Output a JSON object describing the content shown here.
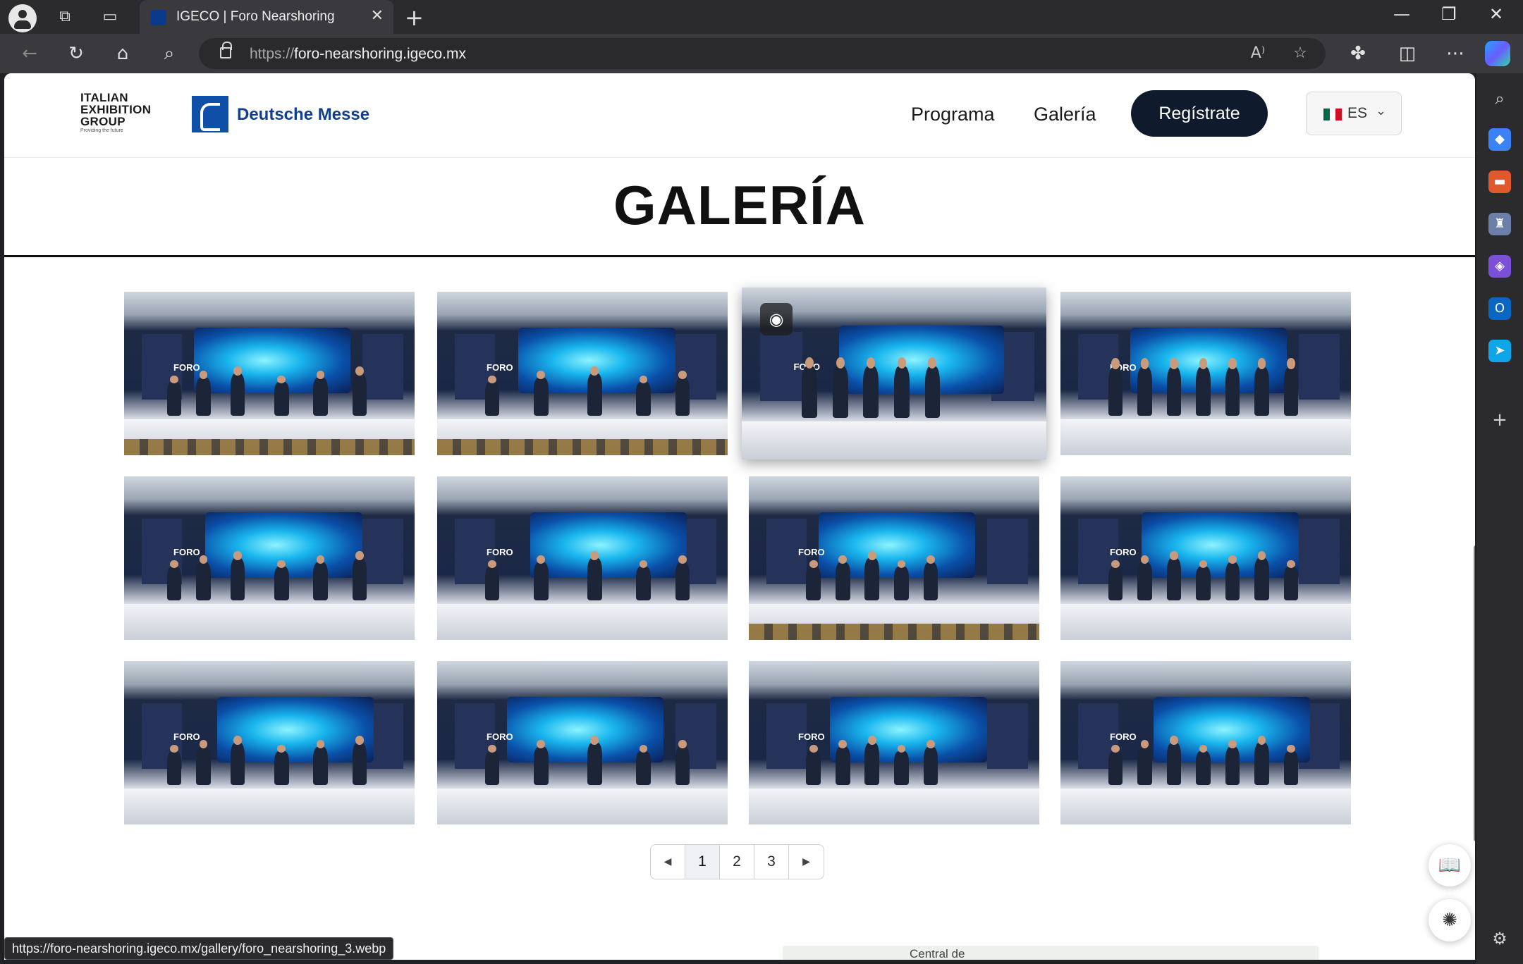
{
  "browser": {
    "tab_title": "IGECO | Foro Nearshoring",
    "url_protocol": "https://",
    "url_host": "foro-nearshoring.igeco.mx",
    "status_url": "https://foro-nearshoring.igeco.mx/gallery/foro_nearshoring_3.webp"
  },
  "header": {
    "ieg_logo_lines": [
      "ITALIAN",
      "EXHIBITION",
      "GROUP"
    ],
    "ieg_tagline": "Providing the future",
    "partner_logo": "Deutsche Messe",
    "nav": [
      "Programa",
      "Galería"
    ],
    "cta_label": "Regístrate",
    "language": "ES",
    "flag_colors": [
      "#006847",
      "#ffffff",
      "#ce1126"
    ]
  },
  "gallery": {
    "title": "GALERÍA",
    "photos": [
      {
        "alt": "Panel discussion on stage",
        "overlay": "FORO"
      },
      {
        "alt": "Panel speakers with Italian Exhibition screen",
        "overlay": "FORO"
      },
      {
        "alt": "Group photo of speakers on stage",
        "overlay": "FORO",
        "hovered": true
      },
      {
        "alt": "Speakers group photo",
        "overlay": "FORO"
      },
      {
        "alt": "Panel on nearshoring trends",
        "overlay": "FORO"
      },
      {
        "alt": "Speaker addressing panel",
        "overlay": "FORO"
      },
      {
        "alt": "Audience view of panel",
        "overlay": "FORO"
      },
      {
        "alt": "Wide shot of panel stage",
        "overlay": "FORO"
      },
      {
        "alt": "Panel with podium",
        "overlay": "FORO"
      },
      {
        "alt": "Moderator with microphone",
        "overlay": "FORO"
      },
      {
        "alt": "Group photo with awards",
        "overlay": "FORO"
      },
      {
        "alt": "Panel from audience seats",
        "overlay": "FORO"
      }
    ]
  },
  "pagination": {
    "prev_icon": "caret-left-icon",
    "pages": [
      "1",
      "2",
      "3"
    ],
    "current": "1",
    "next_icon": "caret-right-icon"
  },
  "map_peek_label": "Central de"
}
